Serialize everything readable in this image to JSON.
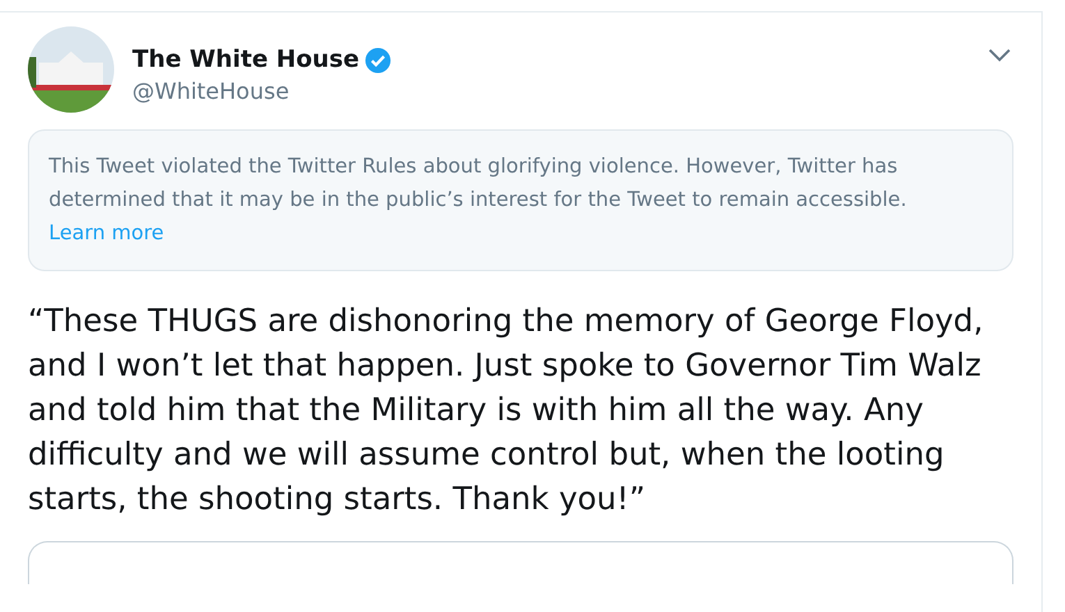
{
  "tweet": {
    "author": {
      "name": "The White House",
      "verified": true,
      "handle": "@WhiteHouse"
    },
    "notice": {
      "text": "This Tweet violated the Twitter Rules about glorifying violence. However, Twitter has determined that it may be in the public’s interest for the Tweet to remain accessible.",
      "link": "Learn more"
    },
    "text": "“These THUGS are dishonoring the memory of George Floyd, and I won’t let that happen. Just spoke to Governor Tim Walz and told him that the Military is with him all the way. Any difficulty and we will assume control but, when the looting starts, the shooting starts. Thank you!”"
  }
}
